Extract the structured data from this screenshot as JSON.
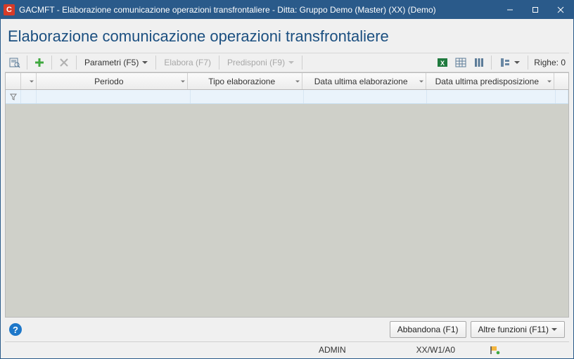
{
  "window": {
    "title": "GACMFT - Elaborazione comunicazione operazioni transfrontaliere - Ditta: Gruppo Demo (Master) (XX)  (Demo)"
  },
  "page": {
    "title": "Elaborazione comunicazione operazioni transfrontaliere"
  },
  "toolbar": {
    "parametri": "Parametri (F5)",
    "elabora": "Elabora (F7)",
    "predisponi": "Predisponi (F9)",
    "righe_label": "Righe:",
    "righe_count": "0"
  },
  "grid": {
    "columns": {
      "periodo": "Periodo",
      "tipo_elaborazione": "Tipo elaborazione",
      "data_ultima_elaborazione": "Data ultima elaborazione",
      "data_ultima_predisposizione": "Data ultima predisposizione"
    },
    "rows": []
  },
  "bottom": {
    "abbandona": "Abbandona (F1)",
    "altre_funzioni": "Altre funzioni (F11)"
  },
  "status": {
    "user": "ADMIN",
    "env": "XX/W1/A0"
  }
}
